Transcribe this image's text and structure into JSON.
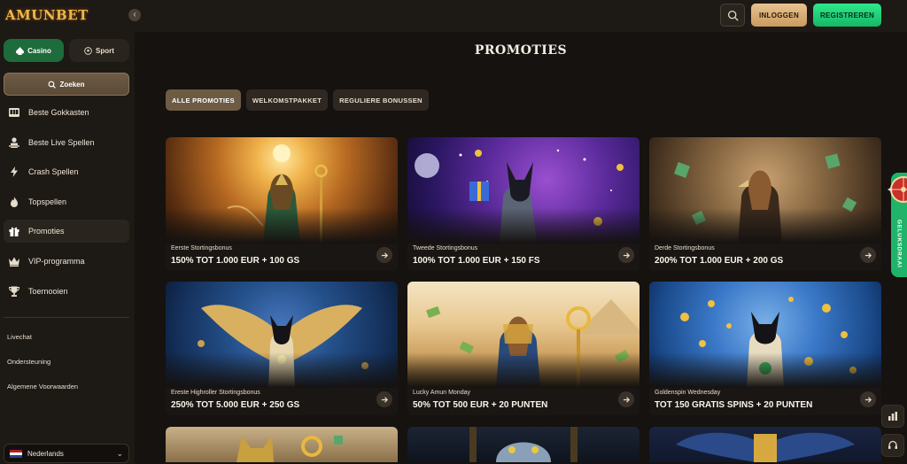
{
  "header": {
    "logo_text": "AMUNBET",
    "login_label": "INLOGGEN",
    "register_label": "REGISTREREN",
    "search_icon": "search-icon",
    "colors": {
      "login": "#d9b27a",
      "register": "#22d477",
      "background": "#1d1915"
    }
  },
  "sidebar": {
    "segment": {
      "casino": "Casino",
      "sport": "Sport",
      "active": "Casino"
    },
    "search_label": "Zoeken",
    "items": [
      {
        "label": "Beste Gokkasten",
        "icon": "slot-machine-icon",
        "active": false
      },
      {
        "label": "Beste Live Spellen",
        "icon": "dealer-icon",
        "active": false
      },
      {
        "label": "Crash Spellen",
        "icon": "lightning-icon",
        "active": false
      },
      {
        "label": "Topspellen",
        "icon": "flame-icon",
        "active": false
      },
      {
        "label": "Promoties",
        "icon": "gift-icon",
        "active": true
      },
      {
        "label": "VIP-programma",
        "icon": "crown-icon",
        "active": false
      },
      {
        "label": "Toernooien",
        "icon": "trophy-icon",
        "active": false
      }
    ],
    "links": [
      "Livechat",
      "Ondersteuning",
      "Algemene Voorwaarden"
    ],
    "language": "Nederlands"
  },
  "main": {
    "title": "PROMOTIES",
    "filters": [
      {
        "label": "ALLE PROMOTIES",
        "active": true
      },
      {
        "label": "WELKOMSTPAKKET",
        "active": false
      },
      {
        "label": "REGULIERE BONUSSEN",
        "active": false
      }
    ],
    "cards": [
      {
        "subtitle": "Eerste Stortingsbonus",
        "title": "150% TOT 1.000 EUR + 100 GS",
        "theme": "desert-gold"
      },
      {
        "subtitle": "Tweede Stortingsbonus",
        "title": "100% TOT 1.000 EUR + 150 FS",
        "theme": "cosmic-purple"
      },
      {
        "subtitle": "Derde Stortingsbonus",
        "title": "200% TOT 1.000 EUR + 200 GS",
        "theme": "bronze-dice"
      },
      {
        "subtitle": "Ereste Highroller Stortingsbonus",
        "title": "250% TOT 5.000 EUR + 250 GS",
        "theme": "blue-winged"
      },
      {
        "subtitle": "Lucky Amun Monday",
        "title": "50% TOT 500 EUR + 20 PUNTEN",
        "theme": "pyramid-sand"
      },
      {
        "subtitle": "Goldenspin Wednesday",
        "title": "TOT 150 GRATIS SPINS + 20 PUNTEN",
        "theme": "oasis-blue"
      }
    ]
  },
  "floating": {
    "wheel_label": "GELUKSDRAAI"
  }
}
